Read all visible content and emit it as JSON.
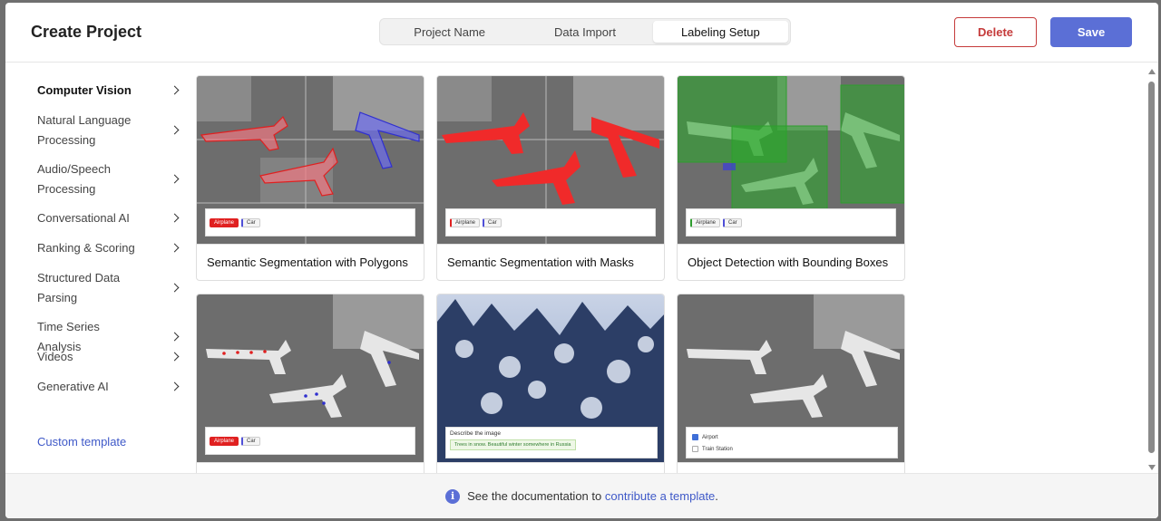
{
  "header": {
    "title": "Create Project",
    "tabs": [
      "Project Name",
      "Data Import",
      "Labeling Setup"
    ],
    "active_tab": "Labeling Setup",
    "delete_label": "Delete",
    "save_label": "Save"
  },
  "sidebar": {
    "items": [
      {
        "label": "Computer Vision",
        "active": true
      },
      {
        "label": "Natural Language Processing"
      },
      {
        "label": "Audio/Speech Processing"
      },
      {
        "label": "Conversational AI"
      },
      {
        "label": "Ranking & Scoring"
      },
      {
        "label": "Structured Data Parsing"
      },
      {
        "label": "Time Series Analysis"
      },
      {
        "label": "Videos"
      },
      {
        "label": "Generative AI"
      }
    ],
    "custom_template": "Custom template"
  },
  "cards": [
    {
      "title": "Semantic Segmentation with Polygons",
      "tags": [
        "Airplane",
        "Car"
      ]
    },
    {
      "title": "Semantic Segmentation with Masks",
      "tags": [
        "Airplane",
        "Car"
      ]
    },
    {
      "title": "Object Detection with Bounding Boxes",
      "tags": [
        "Airplane",
        "Car"
      ]
    },
    {
      "title": "",
      "tags": [
        "Airplane",
        "Car"
      ]
    },
    {
      "title": "",
      "prompt": "Describe the image",
      "answer": "Trees in snow. Beautiful winter somewhere in Russia"
    },
    {
      "title": "",
      "options": [
        "Airport",
        "Train Station"
      ]
    }
  ],
  "footer": {
    "text": "See the documentation to",
    "link": "contribute a template",
    "suffix": "."
  },
  "colors": {
    "accent": "#5b6fd6",
    "danger": "#c53b3b",
    "link": "#3f59c8"
  }
}
